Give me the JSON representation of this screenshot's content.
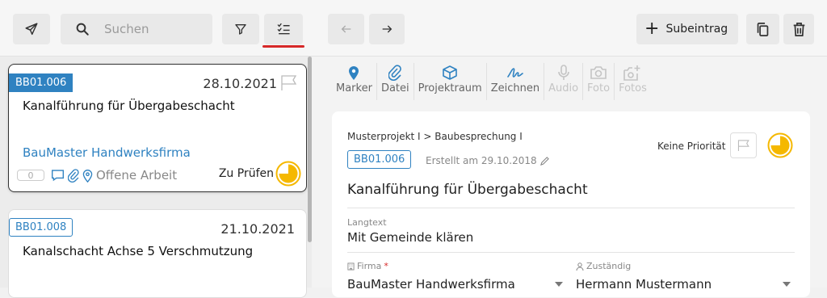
{
  "topbar": {
    "search_placeholder": "Suchen",
    "subeintrag_label": "Subeintrag"
  },
  "colors": {
    "accent_blue": "#2f82c1",
    "active_underline": "#d62828",
    "status_yellow": "#f5b800"
  },
  "icons": {
    "send": "paper-plane-icon",
    "search": "search-icon",
    "filter": "filter-icon",
    "checklist": "checklist-icon",
    "back": "arrow-left-icon",
    "forward": "arrow-right-icon",
    "copy": "copy-icon",
    "delete": "trash-icon"
  },
  "list": [
    {
      "id": "BB01.006",
      "date": "28.10.2021",
      "title": "Kanalführung für Übergabeschacht",
      "firma": "BauMaster Handwerksfirma",
      "comments": "0",
      "type": "Offene Arbeit",
      "status": "Zu Prüfen",
      "status_progress": 0.75
    },
    {
      "id": "BB01.008",
      "date": "21.10.2021",
      "title": "Kanalschacht Achse 5 Verschmutzung"
    }
  ],
  "toolbar": [
    {
      "label": "Marker",
      "icon": "marker-icon",
      "enabled": true
    },
    {
      "label": "Datei",
      "icon": "paperclip-icon",
      "enabled": true
    },
    {
      "label": "Projektraum",
      "icon": "cube-icon",
      "enabled": true
    },
    {
      "label": "Zeichnen",
      "icon": "signature-icon",
      "enabled": true
    },
    {
      "label": "Audio",
      "icon": "microphone-icon",
      "enabled": false
    },
    {
      "label": "Foto",
      "icon": "camera-icon",
      "enabled": false
    },
    {
      "label": "Fotos",
      "icon": "add-photos-icon",
      "enabled": false
    }
  ],
  "detail": {
    "breadcrumb": "Musterprojekt I > Baubesprechung I",
    "id": "BB01.006",
    "created": "Erstellt am 29.10.2018",
    "priority": "Keine Priorität",
    "title": "Kanalführung für Übergabeschacht",
    "langtext_label": "Langtext",
    "langtext": "Mit Gemeinde klären",
    "firma_label": "Firma",
    "firma_required": "*",
    "firma": "BauMaster Handwerksfirma",
    "zustaendig_label": "Zuständig",
    "zustaendig": "Hermann Mustermann"
  }
}
